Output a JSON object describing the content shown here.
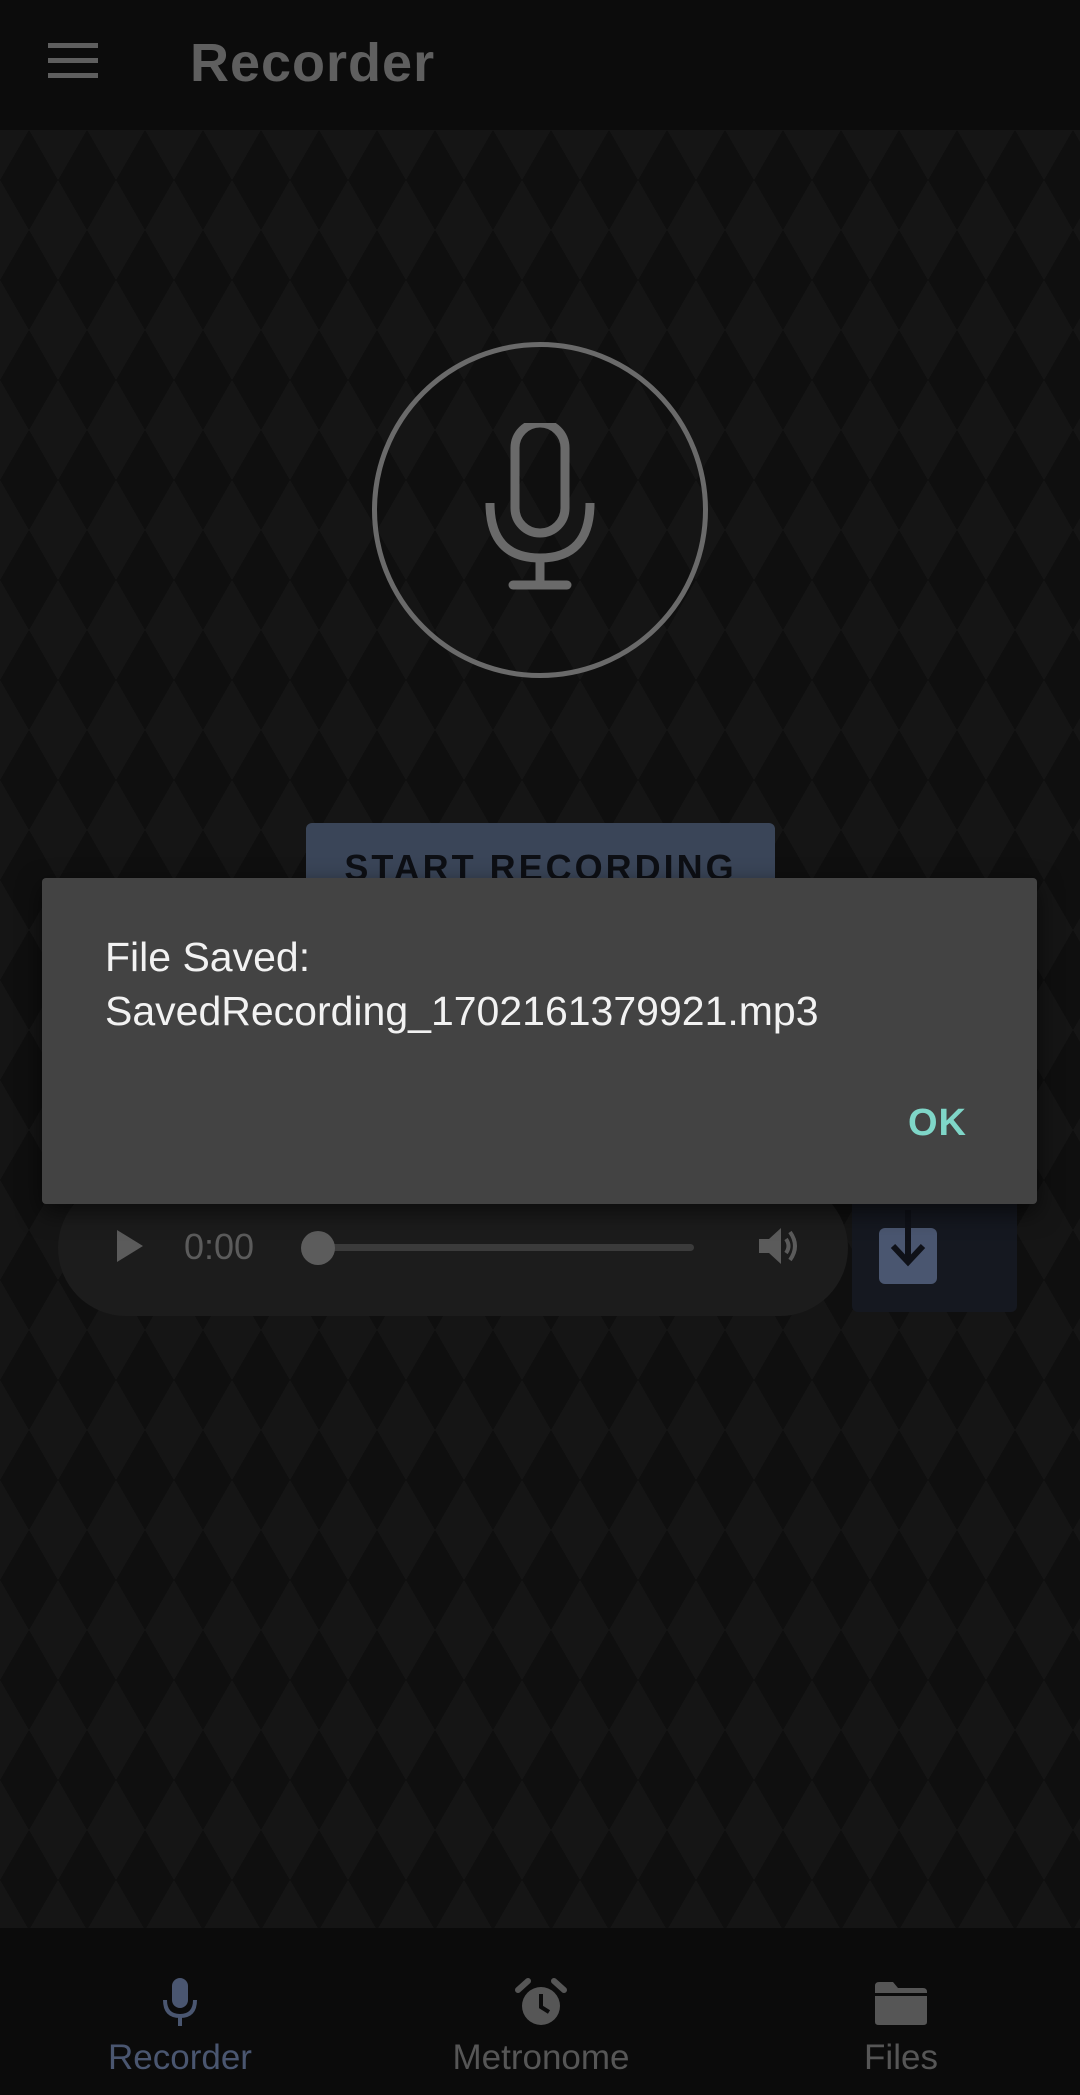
{
  "app_bar": {
    "title": "Recorder",
    "menu_icon": "hamburger-menu-icon"
  },
  "recorder": {
    "mic_icon": "microphone-icon",
    "start_button_label": "START RECORDING"
  },
  "player": {
    "time": "0:00",
    "progress": 0,
    "play_icon": "play-icon",
    "volume_icon": "volume-icon",
    "download_icon": "download-icon"
  },
  "dialog": {
    "message": "File Saved:\nSavedRecording_1702161379921.mp3",
    "ok_label": "OK"
  },
  "bottom_nav": {
    "items": [
      {
        "label": "Recorder",
        "icon": "microphone-icon",
        "active": true
      },
      {
        "label": "Metronome",
        "icon": "alarm-clock-icon",
        "active": false
      },
      {
        "label": "Files",
        "icon": "folder-icon",
        "active": false
      }
    ]
  },
  "colors": {
    "accent": "#7fd6c8",
    "nav_active": "#4a5670",
    "dialog_bg": "#434343",
    "button_bg": "#3a4558"
  }
}
